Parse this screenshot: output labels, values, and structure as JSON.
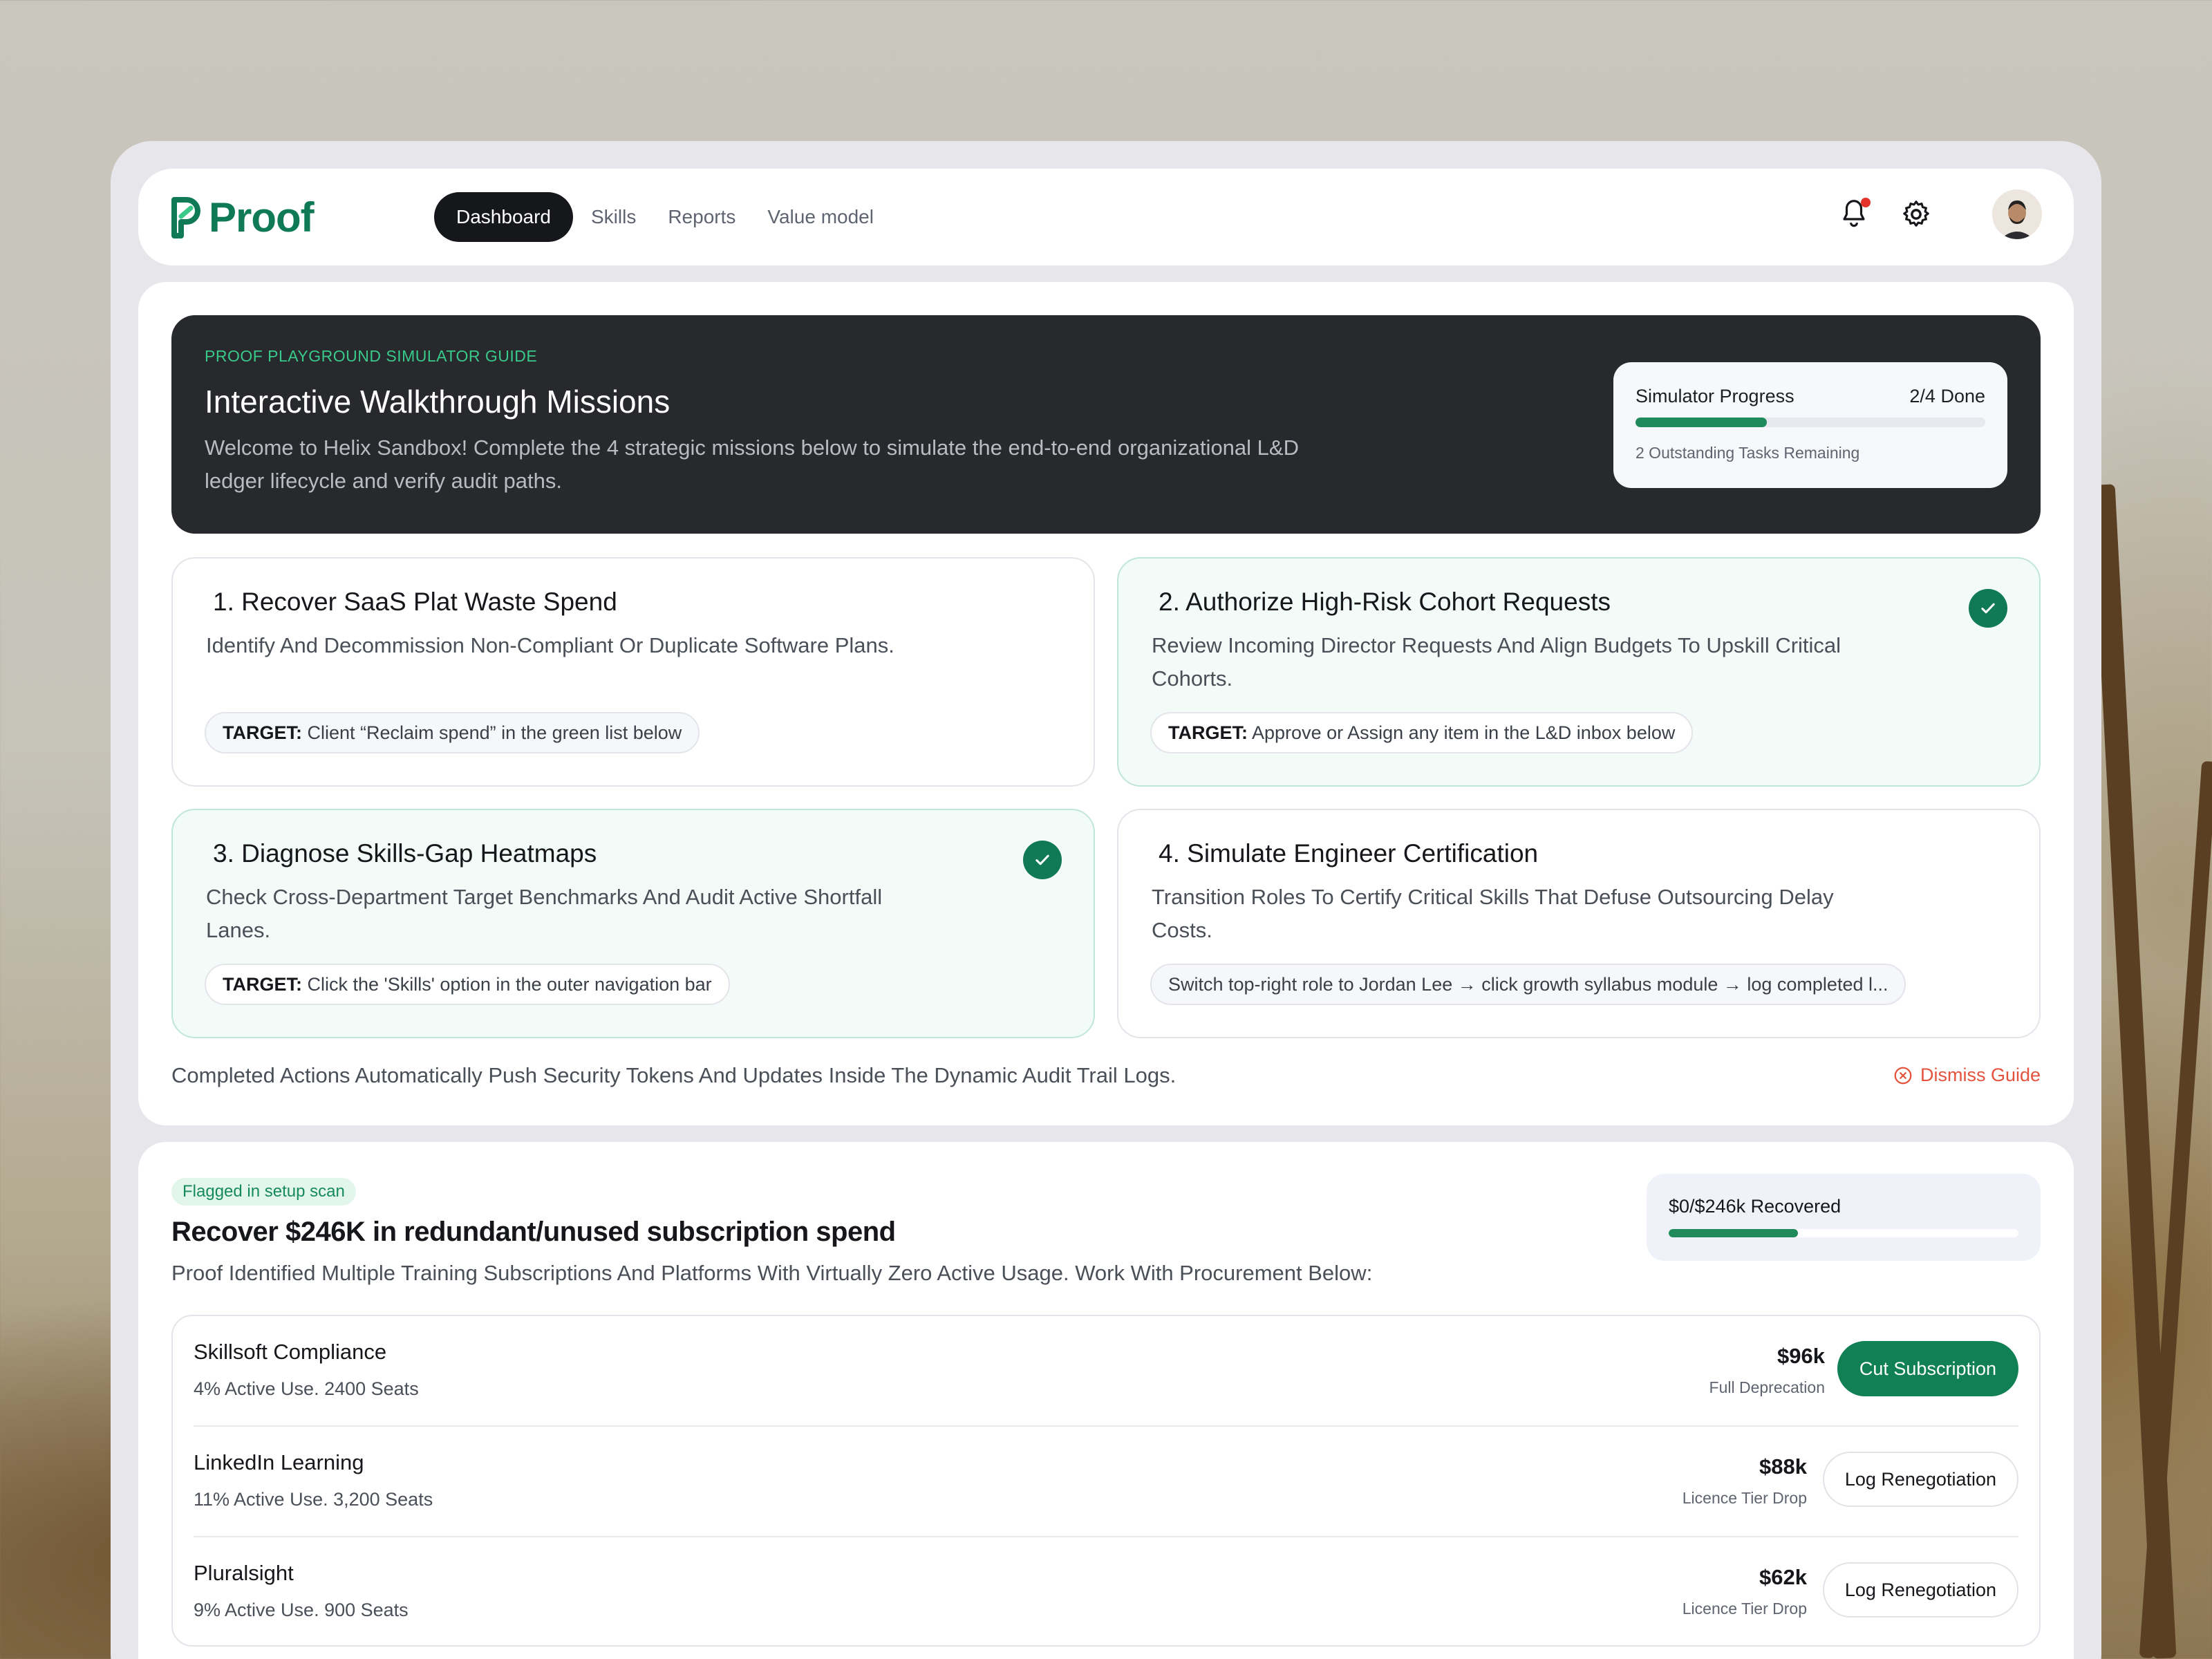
{
  "brand": {
    "name": "Proof",
    "color": "#0f7a55"
  },
  "nav": {
    "tabs": [
      {
        "label": "Dashboard",
        "active": true
      },
      {
        "label": "Skills",
        "active": false
      },
      {
        "label": "Reports",
        "active": false
      },
      {
        "label": "Value model",
        "active": false
      }
    ],
    "icons": [
      "bell-icon",
      "gear-icon",
      "avatar"
    ]
  },
  "guide": {
    "eyebrow": "PROOF PLAYGROUND SIMULATOR GUIDE",
    "title": "Interactive Walkthrough Missions",
    "description": "Welcome to Helix Sandbox! Complete the 4 strategic missions below to simulate the end-to-end organizational L&D ledger lifecycle and verify audit paths.",
    "progress": {
      "label": "Simulator Progress",
      "value": "2/4 Done",
      "fraction": 0.375,
      "sub": "2 Outstanding Tasks Remaining"
    },
    "missions": [
      {
        "title": "1. Recover SaaS Plat Waste Spend",
        "description": "Identify And Decommission Non-Compliant Or Duplicate Software Plans.",
        "target_label": "TARGET:",
        "target_text": "Client “Reclaim spend” in the green list below",
        "done": false
      },
      {
        "title": "2. Authorize High-Risk Cohort Requests",
        "description": "Review Incoming Director Requests And Align Budgets To Upskill Critical Cohorts.",
        "target_label": "TARGET:",
        "target_text": "Approve or Assign any item in the L&D inbox below",
        "done": true
      },
      {
        "title": "3. Diagnose Skills-Gap Heatmaps",
        "description": "Check Cross-Department Target Benchmarks And Audit Active Shortfall Lanes.",
        "target_label": "TARGET:",
        "target_text": "Click the 'Skills' option in the outer navigation bar",
        "done": true
      },
      {
        "title": "4. Simulate Engineer Certification",
        "description": "Transition Roles To Certify Critical Skills That Defuse Outsourcing Delay Costs.",
        "target_label": "",
        "target_text": "Switch top-right role to Jordan Lee → click growth syllabus module → log completed l...",
        "done": false
      }
    ],
    "footer": "Completed Actions Automatically Push Security Tokens And Updates Inside The Dynamic Audit Trail Logs.",
    "dismiss_label": "Dismiss Guide"
  },
  "recover": {
    "flag": "Flagged in setup scan",
    "title": "Recover $246K in redundant/unused subscription spend",
    "description": "Proof Identified Multiple Training Subscriptions And Platforms With Virtually Zero Active Usage. Work With Procurement Below:",
    "recovered": {
      "label": "$0/$246k Recovered",
      "fraction": 0.37
    },
    "rows": [
      {
        "name": "Skillsoft Compliance",
        "usage": "4% Active Use. 2400 Seats",
        "amount": "$96k",
        "note": "Full Deprecation",
        "action": "Cut Subscription",
        "primary": true
      },
      {
        "name": "LinkedIn Learning",
        "usage": "11% Active Use. 3,200 Seats",
        "amount": "$88k",
        "note": "Licence Tier Drop",
        "action": "Log Renegotiation",
        "primary": false
      },
      {
        "name": "Pluralsight",
        "usage": "9% Active Use. 900 Seats",
        "amount": "$62k",
        "note": "Licence Tier Drop",
        "action": "Log Renegotiation",
        "primary": false
      }
    ]
  },
  "colors": {
    "accent": "#0f7a55",
    "dark": "#28292c",
    "danger": "#e3533d",
    "success_bg": "#f2fbf8"
  }
}
